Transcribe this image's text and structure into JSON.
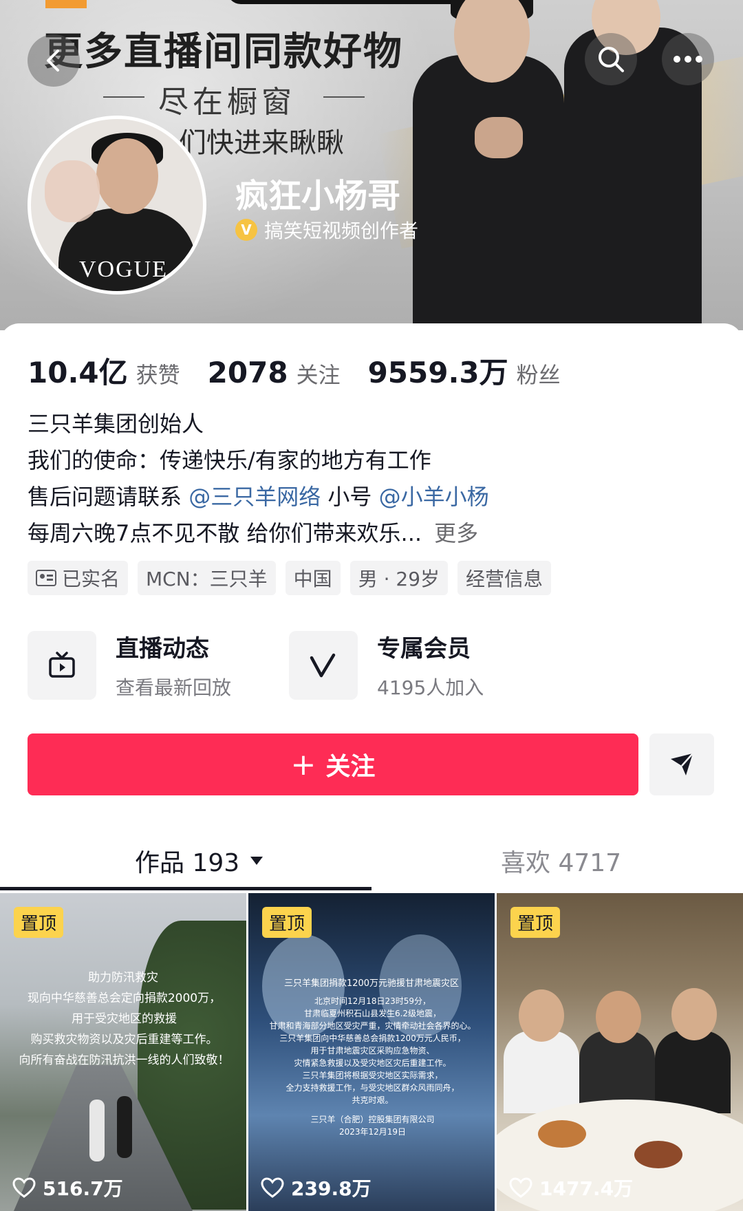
{
  "header": {
    "banner_title": "更多直播间同款好物",
    "banner_subtitle": "尽在橱窗",
    "banner_subtitle2": "们快进来瞅瞅",
    "nickname": "疯狂小杨哥",
    "verify_badge": "V",
    "verify_text": "搞笑短视频创作者",
    "avatar_text": "VOGUE"
  },
  "stats": [
    {
      "value": "10.4亿",
      "label": "获赞"
    },
    {
      "value": "2078",
      "label": "关注"
    },
    {
      "value": "9559.3万",
      "label": "粉丝"
    }
  ],
  "bio": {
    "line1": "三只羊集团创始人",
    "line2": "我们的使命：传递快乐/有家的地方有工作",
    "line3_prefix": "售后问题请联系",
    "line3_mention1": "@三只羊网络",
    "line3_mid": "小号",
    "line3_mention2": "@小羊小杨",
    "line4": "每周六晚7点不见不散  给你们带来欢乐...",
    "more": "更多"
  },
  "tags": {
    "verified": "已实名",
    "mcn": "MCN：三只羊",
    "region": "中国",
    "gender_age": "男 · 29岁",
    "business": "经营信息"
  },
  "features": {
    "live": {
      "title": "直播动态",
      "sub": "查看最新回放",
      "icon": "tv-icon"
    },
    "member": {
      "title": "专属会员",
      "sub": "4195人加入",
      "icon": "v-member-icon"
    }
  },
  "actions": {
    "follow": "关注",
    "follow_plus": "+"
  },
  "tabs": {
    "works": "作品 193",
    "likes": "喜欢 4717"
  },
  "videos": [
    {
      "pinned": "置顶",
      "title": "助力防汛救灾",
      "lines": [
        "现向中华慈善总会定向捐款2000万，",
        "用于受灾地区的救援",
        "购买救灾物资以及灾后重建等工作。",
        "向所有奋战在防汛抗洪一线的人们致敬！"
      ],
      "likes": "516.7万"
    },
    {
      "pinned": "置顶",
      "title": "三只羊集团捐款1200万元驰援甘肃地震灾区",
      "lines": [
        "北京时间12月18日23时59分，",
        "甘肃临夏州积石山县发生6.2级地震，",
        "甘肃和青海部分地区受灾严重，灾情牵动社会各界的心。",
        "三只羊集团向中华慈善总会捐款1200万元人民币，",
        "用于甘肃地震灾区采购应急物资、",
        "灾情紧急救援以及受灾地区灾后重建工作。",
        "三只羊集团将根据受灾地区实际需求，",
        "全力支持救援工作，与受灾地区群众风雨同舟，",
        "共克时艰。",
        "",
        "三只羊（合肥）控股集团有限公司",
        "2023年12月19日"
      ],
      "likes": "239.8万"
    },
    {
      "pinned": "置顶",
      "likes": "1477.4万"
    }
  ]
}
